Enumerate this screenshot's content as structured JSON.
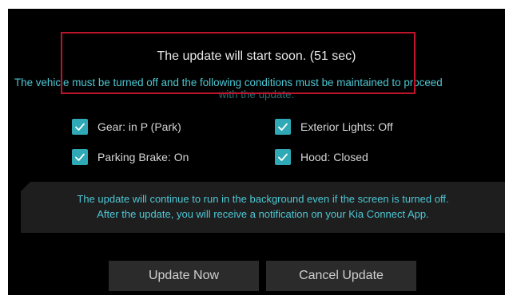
{
  "dialog": {
    "title": "The update will start soon. (51 sec)",
    "instruction": "The vehicle must be turned off and the following conditions must be maintained to proceed",
    "instruction_cont": "with the update.",
    "conditions": [
      {
        "label": "Gear: in P (Park)",
        "checked": true
      },
      {
        "label": "Exterior Lights: Off",
        "checked": true
      },
      {
        "label": "Parking Brake: On",
        "checked": true
      },
      {
        "label": "Hood: Closed",
        "checked": true
      }
    ],
    "info": {
      "line1": "The update will continue to run in the background even if the screen is turned off.",
      "line2": "After the update, you will receive a notification on your Kia Connect App."
    },
    "buttons": {
      "update_now": "Update Now",
      "cancel_update": "Cancel Update"
    }
  },
  "colors": {
    "background": "#000000",
    "accent": "#4ec7d4",
    "checkbox": "#2ea9b5",
    "highlight": "#c0142c",
    "button": "#2b2b2b",
    "panel": "#1e1e1e"
  },
  "icons": {
    "check": "checkmark-icon"
  }
}
